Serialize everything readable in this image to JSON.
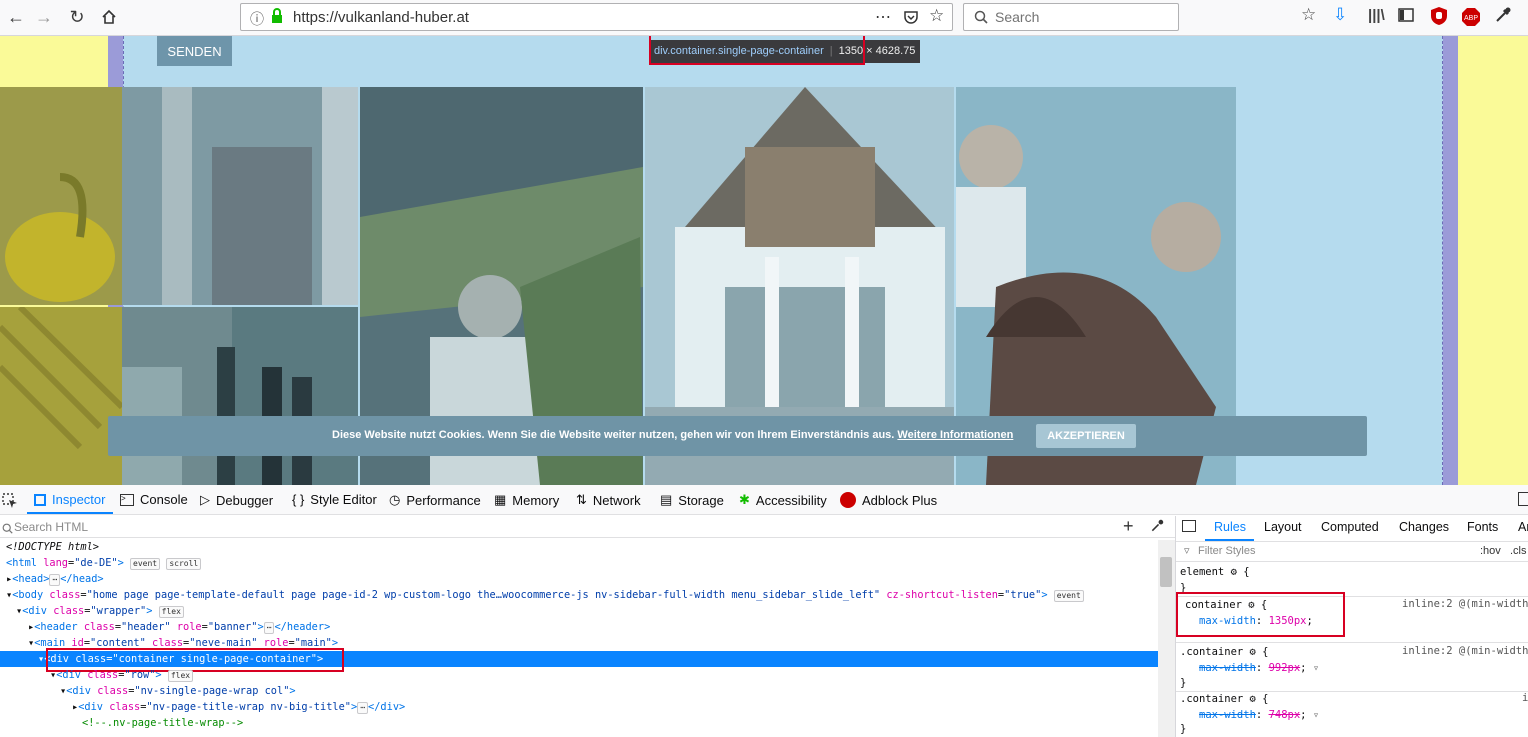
{
  "browser": {
    "url": "https://vulkanland-huber.at",
    "search_placeholder": "Search"
  },
  "page": {
    "senden_label": "SENDEN",
    "cookie_text": "Diese Website nutzt Cookies. Wenn Sie die Website weiter nutzen, gehen wir von Ihrem Einverständnis aus.",
    "cookie_link": "Weitere Informationen",
    "cookie_button": "AKZEPTIEREN"
  },
  "highlighter": {
    "selector": "div.container.single-page-container",
    "size": "1350 × 4628.75"
  },
  "devtools": {
    "tabs": [
      "Inspector",
      "Console",
      "Debugger",
      "Style Editor",
      "Performance",
      "Memory",
      "Network",
      "Storage",
      "Accessibility",
      "Adblock Plus"
    ],
    "search_html": "Search HTML"
  },
  "markup": {
    "l1": "<!DOCTYPE html>",
    "l2_tag": "<html",
    "l2_attr": "lang",
    "l2_val": "\"de-DE\"",
    "l2_end": ">",
    "badge_event": "event",
    "badge_scroll": "scroll",
    "l3": "<head>",
    "l3b": "</head>",
    "l4_tag": "<body",
    "l4_attr": "class",
    "l4_val": "\"home page page-template-default page page-id-2 wp-custom-logo the…woocommerce-js nv-sidebar-full-width menu_sidebar_slide_left\"",
    "l4_attr2": "cz-shortcut-listen",
    "l4_val2": "\"true\"",
    "l4_end": ">",
    "l5_tag": "<div",
    "l5_attr": "class",
    "l5_val": "\"wrapper\"",
    "l5_end": ">",
    "badge_flex": "flex",
    "l6_tag": "<header",
    "l6_attr": "class",
    "l6_val": "\"header\"",
    "l6_attr2": "role",
    "l6_val2": "\"banner\"",
    "l6_end": ">",
    "l6_close": "</header>",
    "l7_tag": "<main",
    "l7_attr": "id",
    "l7_val": "\"content\"",
    "l7_attr2": "class",
    "l7_val2": "\"neve-main\"",
    "l7_attr3": "role",
    "l7_val3": "\"main\"",
    "l7_end": ">",
    "l8": "<div class=\"container single-page-container\">",
    "l9_tag": "<div",
    "l9_attr": "class",
    "l9_val": "\"row\"",
    "l9_end": ">",
    "l10_tag": "<div",
    "l10_attr": "class",
    "l10_val": "\"nv-single-page-wrap col\"",
    "l10_end": ">",
    "l11_tag": "<div",
    "l11_attr": "class",
    "l11_val": "\"nv-page-title-wrap nv-big-title\"",
    "l11_end": ">",
    "l11_close": "</div>",
    "l12": "<!--.nv-page-title-wrap-->"
  },
  "rules": {
    "tabs": [
      "Rules",
      "Layout",
      "Computed",
      "Changes",
      "Fonts",
      "An"
    ],
    "filter": "Filter Styles",
    "hov": ":hov",
    "cls": ".cls",
    "element": "element",
    "r1_sel": "container",
    "r1_prop": "max-width",
    "r1_val": "1350px",
    "r1_src": "inline:2 @(min-width:",
    "r2_sel": ".container",
    "r2_prop": "max-width",
    "r2_val": "992px",
    "r2_src": "inline:2 @(min-width:",
    "r3_sel": ".container",
    "r3_prop": "max-width",
    "r3_val": "748px",
    "r3_src": "i"
  }
}
